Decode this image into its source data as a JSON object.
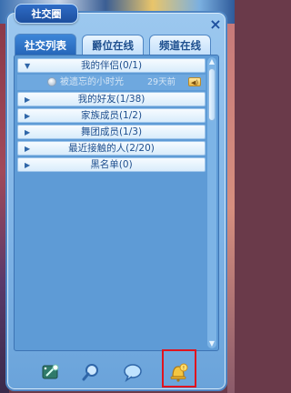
{
  "window": {
    "title": "社交圈",
    "close_label": "×"
  },
  "tabs": [
    {
      "label": "社交列表",
      "active": true
    },
    {
      "label": "爵位在线",
      "active": false
    },
    {
      "label": "频道在线",
      "active": false
    }
  ],
  "groups": [
    {
      "label": "我的伴侣(0/1)",
      "expanded": true,
      "members": [
        {
          "name": "被遗忘的小时光",
          "time": "29天前",
          "voice_icon": "speaker-icon"
        }
      ]
    },
    {
      "label": "我的好友(1/38)",
      "expanded": false
    },
    {
      "label": "家族成员(1/2)",
      "expanded": false
    },
    {
      "label": "舞团成员(1/3)",
      "expanded": false
    },
    {
      "label": "最近接触的人(2/20)",
      "expanded": false
    },
    {
      "label": "黑名单(0)",
      "expanded": false
    }
  ],
  "bottom_buttons": [
    {
      "icon": "add-friend-icon"
    },
    {
      "icon": "search-icon"
    },
    {
      "icon": "chat-bubble-icon"
    },
    {
      "icon": "notification-bell-icon",
      "highlighted": true
    }
  ],
  "colors": {
    "accent": "#2565b8",
    "highlight": "#e0141e"
  }
}
